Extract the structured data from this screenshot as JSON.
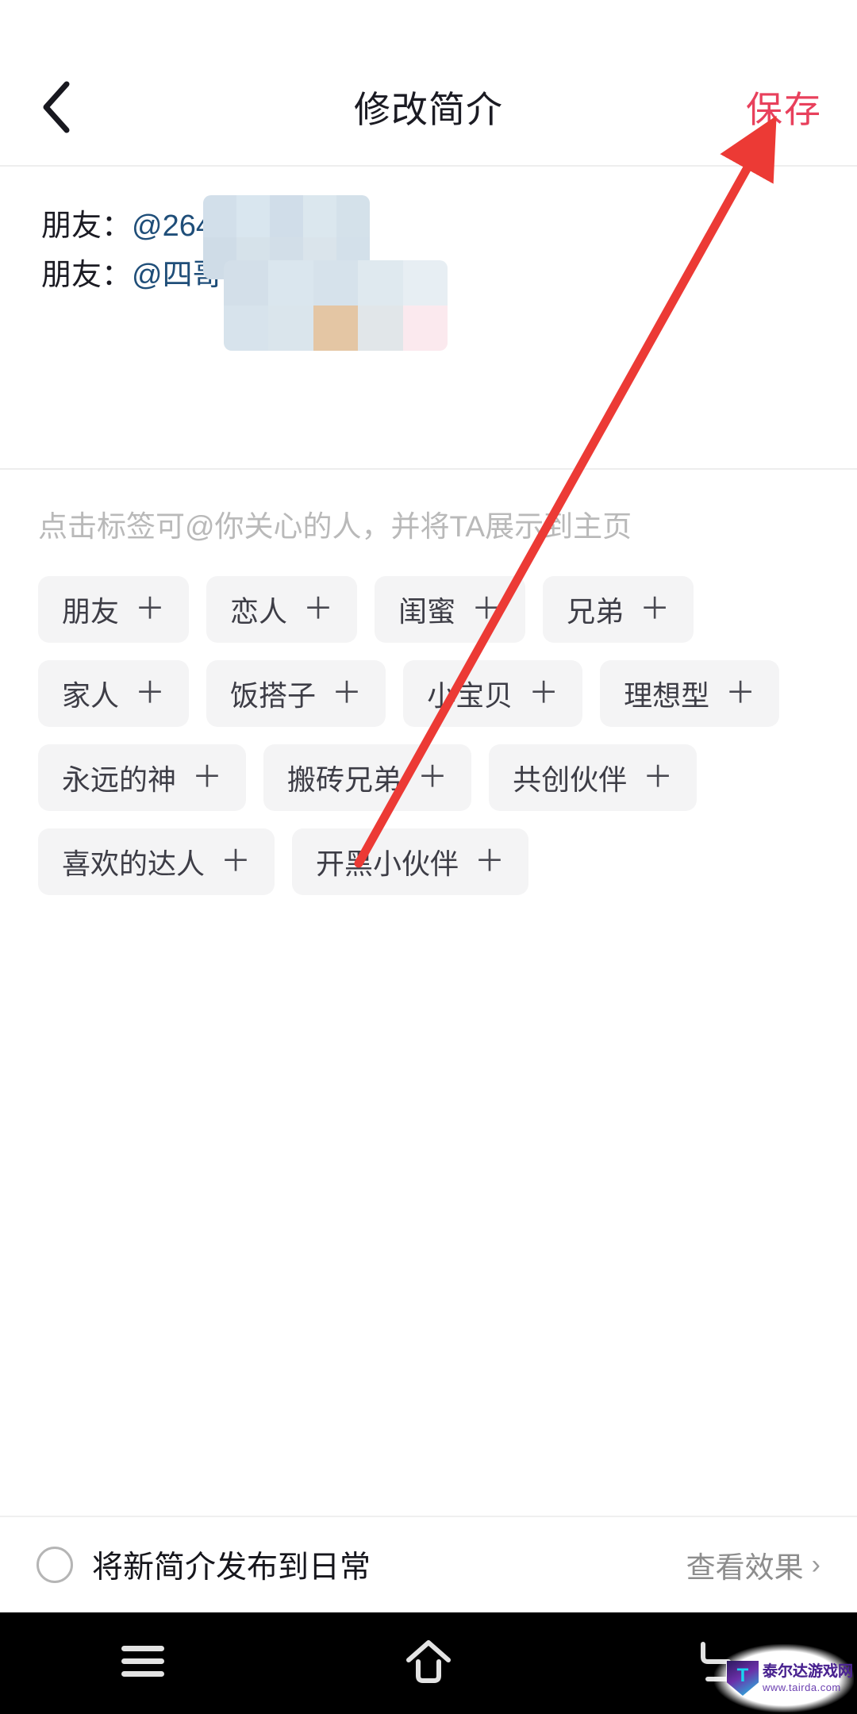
{
  "header": {
    "back_icon": "chevron-left-icon",
    "title": "修改简介",
    "save_label": "保存",
    "save_color": "#e8405c"
  },
  "bio": {
    "lines": [
      {
        "label": "朋友：",
        "mention": "@2643",
        "censored": true
      },
      {
        "label": "朋友：",
        "mention": "@四哥",
        "censored": true
      }
    ]
  },
  "tags": {
    "hint": "点击标签可@你关心的人，并将TA展示到主页",
    "plus_glyph": "＋",
    "rows": [
      [
        {
          "label": "朋友"
        },
        {
          "label": "恋人"
        },
        {
          "label": "闺蜜"
        },
        {
          "label": "兄弟"
        }
      ],
      [
        {
          "label": "家人"
        },
        {
          "label": "饭搭子"
        },
        {
          "label": "小宝贝"
        },
        {
          "label": "理想型"
        }
      ],
      [
        {
          "label": "永远的神"
        },
        {
          "label": "搬砖兄弟"
        },
        {
          "label": "共创伙伴"
        }
      ],
      [
        {
          "label": "喜欢的达人"
        },
        {
          "label": "开黑小伙伴"
        }
      ]
    ]
  },
  "bottom": {
    "checkbox_checked": false,
    "publish_label": "将新简介发布到日常",
    "preview_label": "查看效果",
    "chevron": "›"
  },
  "navbar": {
    "items": [
      {
        "icon": "menu-icon"
      },
      {
        "icon": "home-icon"
      },
      {
        "icon": "back-return-icon"
      }
    ]
  },
  "watermark": {
    "site_name": "泰尔达游戏网",
    "url": "www.tairda.com"
  },
  "annotation": {
    "color": "#ec3a35",
    "type": "arrow",
    "points_to": "保存"
  },
  "mosaic_colors": {
    "blue_light": "#d9e6ef",
    "blue_mid": "#ccd9e6",
    "blue_pale": "#dde7ee",
    "tan": "#e4c6a4",
    "gray": "#e1e6e9",
    "pink": "#fbe9ee",
    "white": "#ffffff"
  }
}
